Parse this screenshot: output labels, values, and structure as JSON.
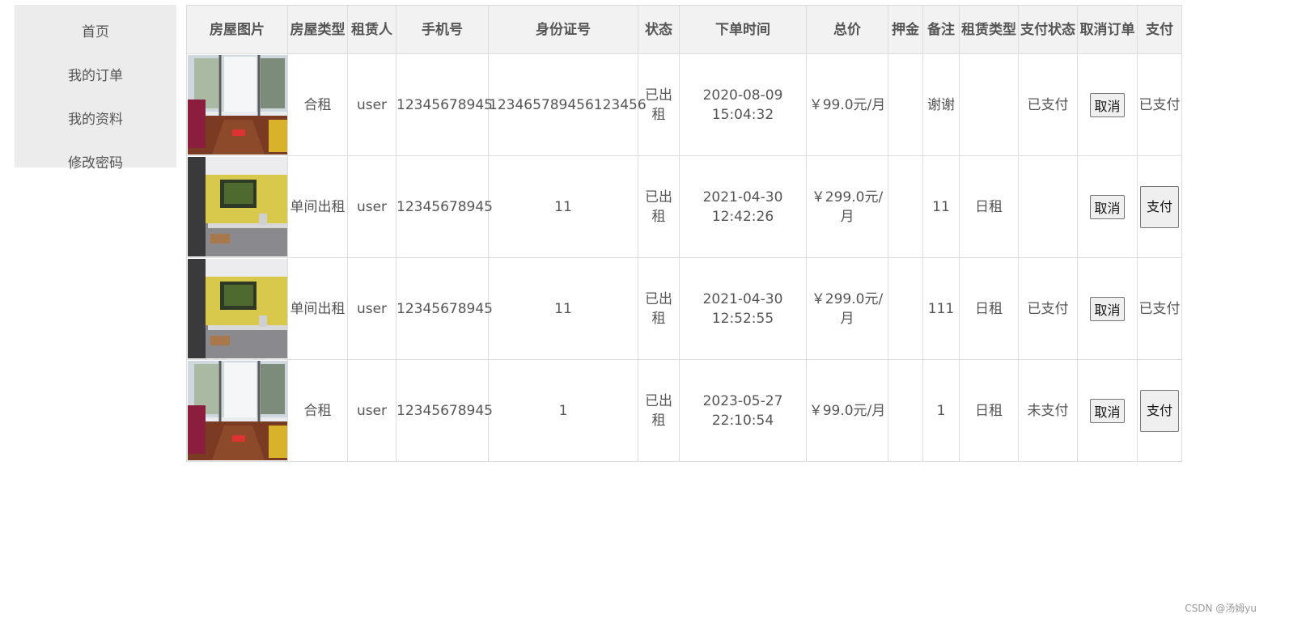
{
  "sidebar": {
    "items": [
      {
        "label": "首页"
      },
      {
        "label": "我的订单"
      },
      {
        "label": "我的资料"
      },
      {
        "label": "修改密码"
      }
    ]
  },
  "table": {
    "headers": [
      "房屋图片",
      "房屋类型",
      "租赁人",
      "手机号",
      "身份证号",
      "状态",
      "下单时间",
      "总价",
      "押金",
      "备注",
      "租赁类型",
      "支付状态",
      "取消订单",
      "支付"
    ],
    "rows": [
      {
        "image": "living-room-photo",
        "house_type": "合租",
        "tenant": "user",
        "phone": "12345678945",
        "id_number": "123465789456123456",
        "status": "已出租",
        "order_time": "2020-08-09 15:04:32",
        "total_price": "￥99.0元/月",
        "deposit": "",
        "remark": "谢谢",
        "rent_type": "",
        "pay_status": "已支付",
        "cancel_label": "取消",
        "pay": "已支付"
      },
      {
        "image": "kitchen-photo",
        "house_type": "单间出租",
        "tenant": "user",
        "phone": "12345678945",
        "id_number": "11",
        "status": "已出租",
        "order_time": "2021-04-30 12:42:26",
        "total_price": "￥299.0元/月",
        "deposit": "",
        "remark": "11",
        "rent_type": "日租",
        "pay_status": "",
        "cancel_label": "取消",
        "pay": "支付"
      },
      {
        "image": "kitchen-photo",
        "house_type": "单间出租",
        "tenant": "user",
        "phone": "12345678945",
        "id_number": "11",
        "status": "已出租",
        "order_time": "2021-04-30 12:52:55",
        "total_price": "￥299.0元/月",
        "deposit": "",
        "remark": "111",
        "rent_type": "日租",
        "pay_status": "已支付",
        "cancel_label": "取消",
        "pay": "已支付"
      },
      {
        "image": "living-room-photo",
        "house_type": "合租",
        "tenant": "user",
        "phone": "12345678945",
        "id_number": "1",
        "status": "已出租",
        "order_time": "2023-05-27 22:10:54",
        "total_price": "￥99.0元/月",
        "deposit": "",
        "remark": "1",
        "rent_type": "日租",
        "pay_status": "未支付",
        "cancel_label": "取消",
        "pay": "支付"
      }
    ]
  },
  "footer": {
    "credit": "CSDN @汤姆yu"
  },
  "colors": {
    "status": "#e00000",
    "header_bg": "#f2f2f2",
    "sidebar_bg": "#ececec"
  }
}
